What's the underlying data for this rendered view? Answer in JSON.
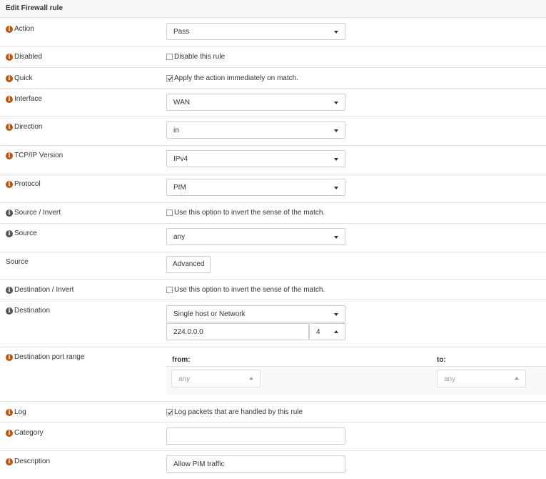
{
  "header": {
    "title": "Edit Firewall rule"
  },
  "action": {
    "label": "Action",
    "value": "Pass"
  },
  "disabled": {
    "label": "Disabled",
    "checkbox_label": "Disable this rule",
    "checked": false
  },
  "quick": {
    "label": "Quick",
    "checkbox_label": "Apply the action immediately on match.",
    "checked": true
  },
  "interface": {
    "label": "Interface",
    "value": "WAN"
  },
  "direction": {
    "label": "Direction",
    "value": "in"
  },
  "ip_version": {
    "label": "TCP/IP Version",
    "value": "IPv4"
  },
  "protocol": {
    "label": "Protocol",
    "value": "PIM"
  },
  "source_invert": {
    "label": "Source / Invert",
    "checkbox_label": "Use this option to invert the sense of the match.",
    "checked": false
  },
  "source": {
    "label": "Source",
    "value": "any"
  },
  "source_advanced": {
    "label": "Source",
    "button_label": "Advanced"
  },
  "destination_invert": {
    "label": "Destination / Invert",
    "checkbox_label": "Use this option to invert the sense of the match.",
    "checked": false
  },
  "destination": {
    "label": "Destination",
    "type_value": "Single host or Network",
    "address": "224.0.0.0",
    "mask": "4"
  },
  "dest_port_range": {
    "label": "Destination port range",
    "from_label": "from:",
    "to_label": "to:",
    "from_value": "any",
    "to_value": "any"
  },
  "log": {
    "label": "Log",
    "checkbox_label": "Log packets that are handled by this rule",
    "checked": true
  },
  "category": {
    "label": "Category",
    "value": ""
  },
  "description": {
    "label": "Description",
    "value": "Allow PIM traffic"
  },
  "colors": {
    "info_orange": "#c2540a",
    "info_gray": "#555555",
    "header_bg": "#f7f7f7",
    "border": "#e3e3e3"
  },
  "icons": {
    "info": "info-circle-icon",
    "dropdown": "caret-down-icon",
    "spinner": "caret-up-icon"
  }
}
